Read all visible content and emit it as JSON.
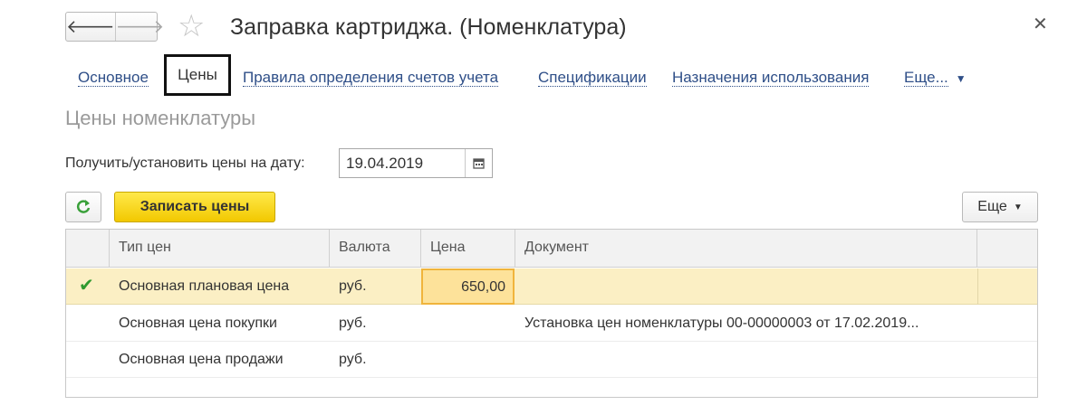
{
  "window": {
    "title": "Заправка картриджа. (Номенклатура)",
    "back_icon": "arrow-left-icon",
    "forward_icon": "arrow-right-icon",
    "favorite_icon": "star-icon",
    "close_icon": "close-icon"
  },
  "tabs": {
    "items": [
      "Основное",
      "Цены",
      "Правила определения счетов учета",
      "Спецификации",
      "Назначения использования",
      "Еще..."
    ],
    "active": "Цены"
  },
  "section": {
    "title": "Цены номенклатуры"
  },
  "date_row": {
    "label": "Получить/установить цены на дату:",
    "value": "19.04.2019"
  },
  "toolbar": {
    "save_label": "Записать цены",
    "more_label": "Еще"
  },
  "table": {
    "columns": [
      "Тип цен",
      "Валюта",
      "Цена",
      "Документ"
    ],
    "rows": [
      {
        "selected": true,
        "type": "Основная плановая цена",
        "currency": "руб.",
        "price": "650,00",
        "document": ""
      },
      {
        "selected": false,
        "type": "Основная цена покупки",
        "currency": "руб.",
        "price": "",
        "document": "Установка цен номенклатуры 00-00000003 от 17.02.2019..."
      },
      {
        "selected": false,
        "type": "Основная цена продажи",
        "currency": "руб.",
        "price": "",
        "document": ""
      }
    ]
  },
  "colors": {
    "accent_yellow": "#f2c800",
    "link_blue": "#2f4f88",
    "row_highlight": "#fbefc4"
  }
}
